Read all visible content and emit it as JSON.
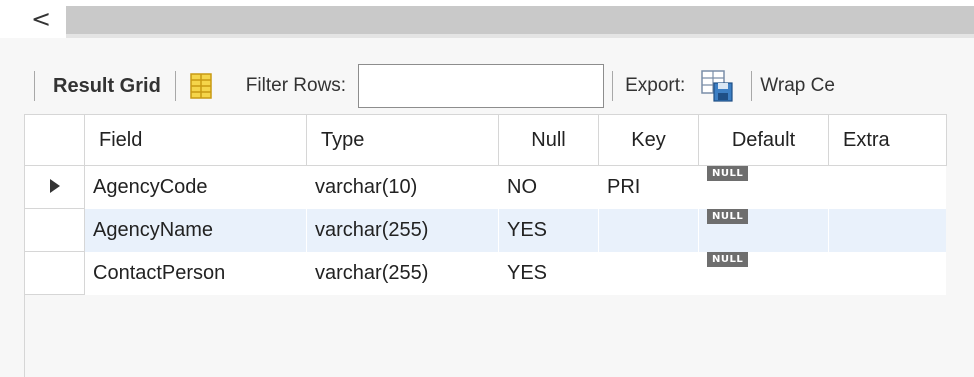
{
  "scroll": {
    "left_glyph": "<"
  },
  "toolbar": {
    "result_grid_label": "Result Grid",
    "filter_label": "Filter Rows:",
    "filter_value": "",
    "export_label": "Export:",
    "wrap_label": "Wrap Ce"
  },
  "grid": {
    "columns": [
      "Field",
      "Type",
      "Null",
      "Key",
      "Default",
      "Extra"
    ],
    "null_badge": "NULL",
    "rows": [
      {
        "field": "AgencyCode",
        "type": "varchar(10)",
        "null": "NO",
        "key": "PRI",
        "default": "NULL",
        "extra": ""
      },
      {
        "field": "AgencyName",
        "type": "varchar(255)",
        "null": "YES",
        "key": "",
        "default": "NULL",
        "extra": ""
      },
      {
        "field": "ContactPerson",
        "type": "varchar(255)",
        "null": "YES",
        "key": "",
        "default": "NULL",
        "extra": ""
      }
    ]
  },
  "colors": {
    "alt_row": "#e9f1fb",
    "null_badge_bg": "#6e6e6e",
    "scroll_track": "#c9c9c9"
  },
  "icons": {
    "grid_view": "grid-view-icon",
    "export": "export-icon",
    "current_row": "current-row-arrow-icon"
  }
}
